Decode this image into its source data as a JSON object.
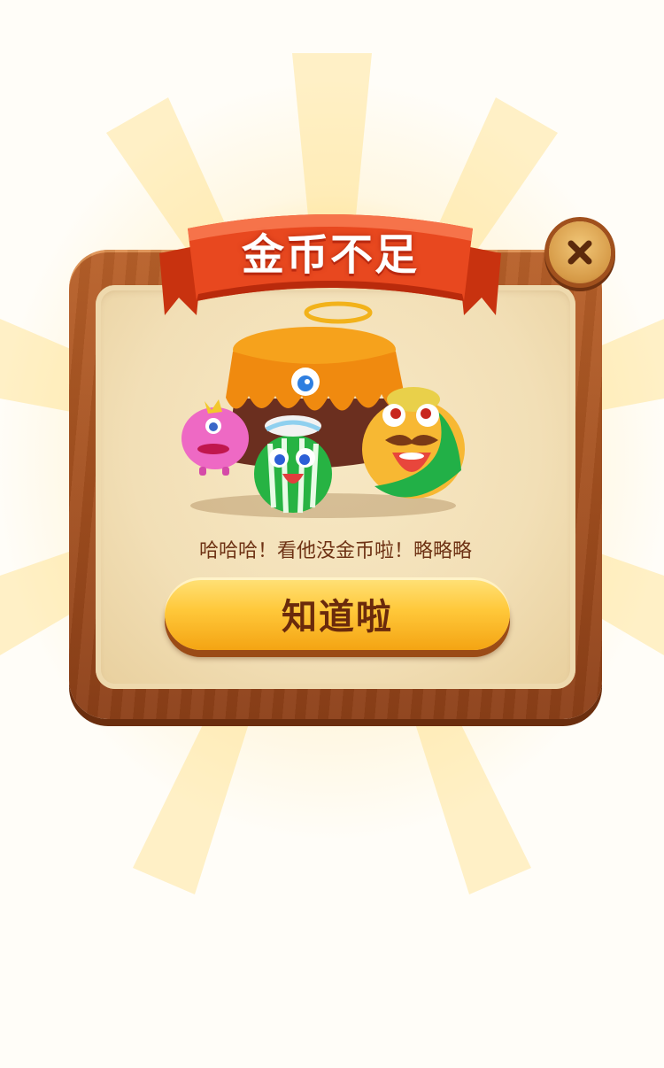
{
  "dialog": {
    "title": "金币不足",
    "message": "哈哈哈！看他没金币啦！略略略",
    "confirm_label": "知道啦",
    "close_icon": "close-icon"
  },
  "colors": {
    "ribbon": "#e8481f",
    "frame": "#a24f1f",
    "panel": "#f2dfb6",
    "button": "#ffc83a",
    "text": "#6e3214"
  },
  "illustration": {
    "icons": [
      "halo-icon",
      "tablecloth-ghost-icon",
      "pink-monster-icon",
      "watermelon-monster-icon",
      "mustache-fruit-monster-icon"
    ]
  }
}
